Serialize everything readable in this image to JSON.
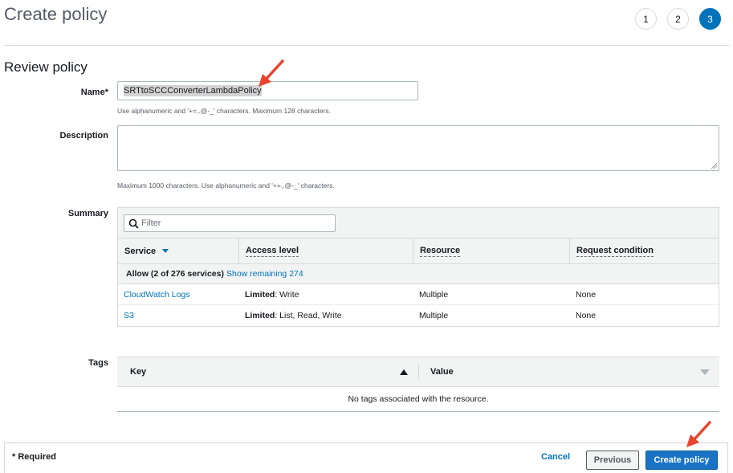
{
  "header": {
    "title": "Create policy",
    "steps": [
      "1",
      "2",
      "3"
    ],
    "active_step": "3"
  },
  "section_title": "Review policy",
  "name_field": {
    "label": "Name*",
    "value": "SRTtoSCCConverterLambdaPolicy",
    "hint": "Use alphanumeric and '+=,.@-_' characters. Maximum 128 characters."
  },
  "description_field": {
    "label": "Description",
    "value": "",
    "hint": "Maximum 1000 characters. Use alphanumeric and '+=,.@-_' characters."
  },
  "summary": {
    "label": "Summary",
    "filter_placeholder": "Filter",
    "columns": [
      "Service",
      "Access level",
      "Resource",
      "Request condition"
    ],
    "group": {
      "title": "Allow (2 of 276 services)",
      "link": "Show remaining 274"
    },
    "rows": [
      {
        "service": "CloudWatch Logs",
        "access_bold": "Limited",
        "access_rest": ": Write",
        "resource": "Multiple",
        "condition": "None"
      },
      {
        "service": "S3",
        "access_bold": "Limited",
        "access_rest": ": List, Read, Write",
        "resource": "Multiple",
        "condition": "None"
      }
    ]
  },
  "tags": {
    "label": "Tags",
    "key_header": "Key",
    "value_header": "Value",
    "empty_text": "No tags associated with the resource."
  },
  "footer": {
    "required_note": "* Required",
    "cancel": "Cancel",
    "previous": "Previous",
    "create": "Create policy"
  },
  "colors": {
    "primary": "#1a73c4",
    "link": "#0073bb",
    "annotation_arrow": "#e8452c"
  }
}
